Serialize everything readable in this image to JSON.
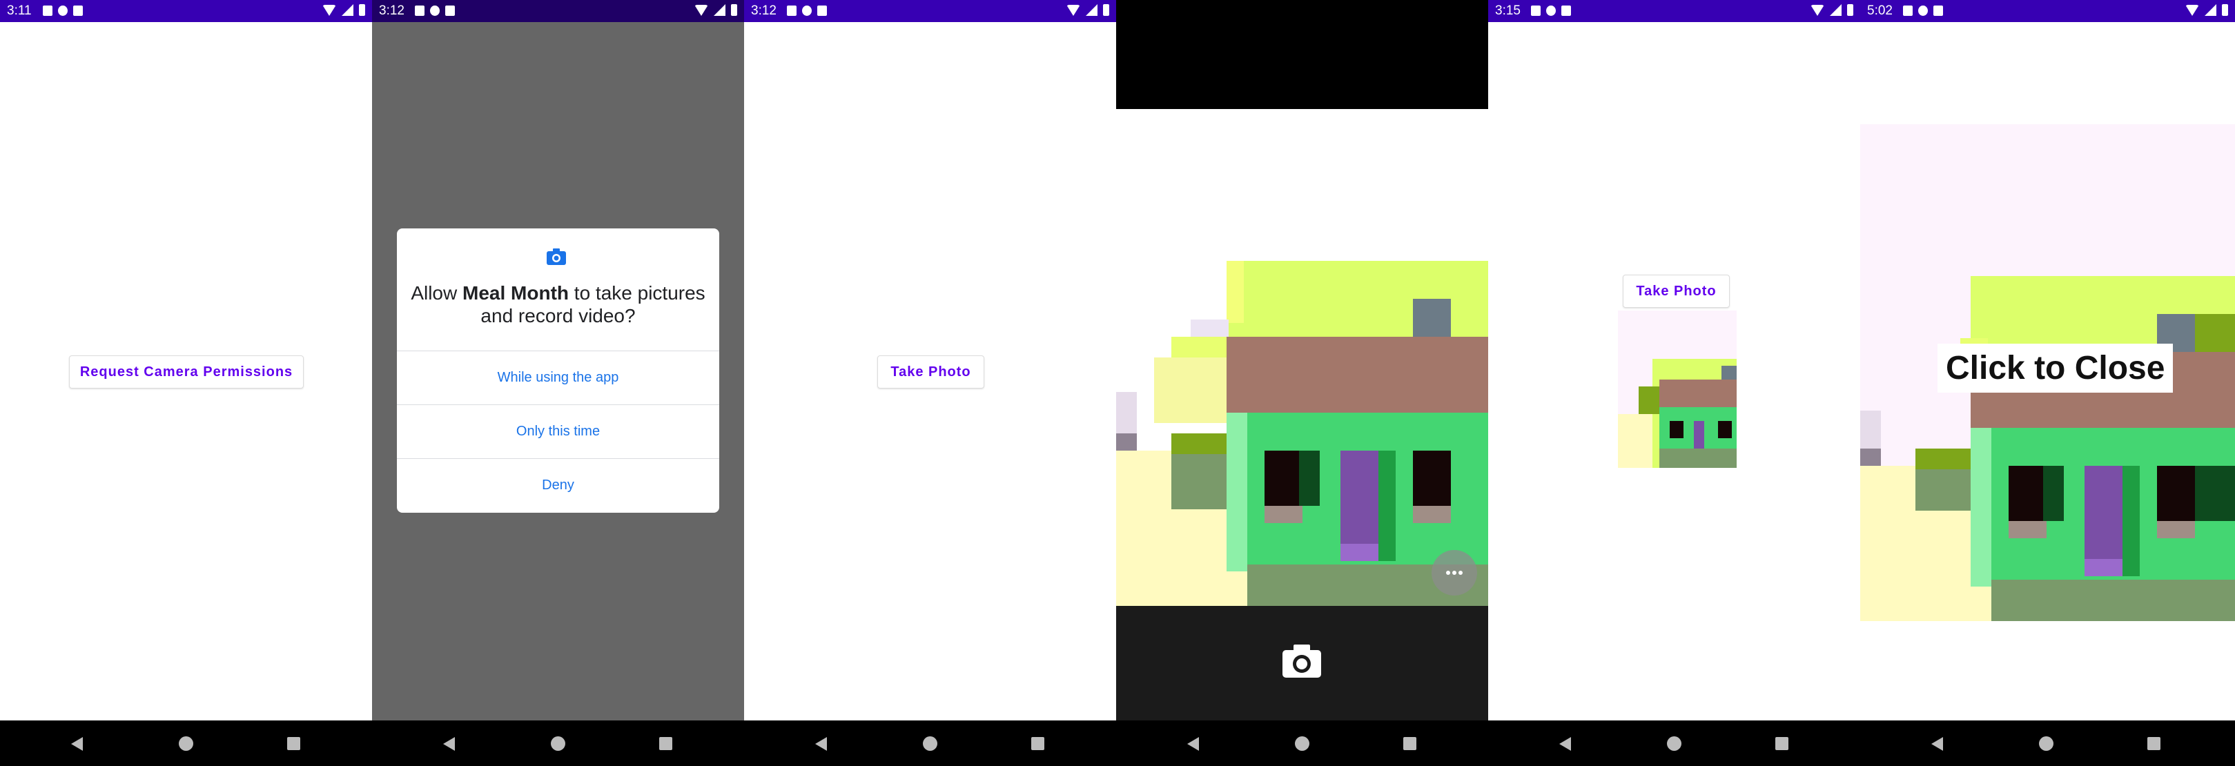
{
  "screens": [
    {
      "time": "3:11",
      "request_permissions_label": "Request Camera Permissions"
    },
    {
      "time": "3:12",
      "dialog": {
        "title_prefix": "Allow ",
        "app_name": "Meal Month",
        "title_suffix": " to take pictures and record video?",
        "options": [
          "While using the app",
          "Only this time",
          "Deny"
        ]
      }
    },
    {
      "time": "3:12",
      "take_photo_label": "Take Photo"
    },
    {
      "time": ""
    },
    {
      "time": "3:15",
      "take_photo_label": "Take Photo"
    },
    {
      "time": "5:02",
      "close_label": "Click to Close"
    }
  ],
  "colors": {
    "status_bar": "#3700b3",
    "accent": "#6200ee",
    "dialog_link": "#1a73e8",
    "house_wall": "#44d672",
    "house_roof": "#a3776a",
    "sky": "#dcff6a",
    "sand": "#fffac0"
  },
  "icons": {
    "dialog": "camera-icon",
    "shutter": "camera-shutter-icon",
    "more": "more-horizontal-icon",
    "nav": [
      "back-icon",
      "home-icon",
      "recents-icon"
    ]
  }
}
